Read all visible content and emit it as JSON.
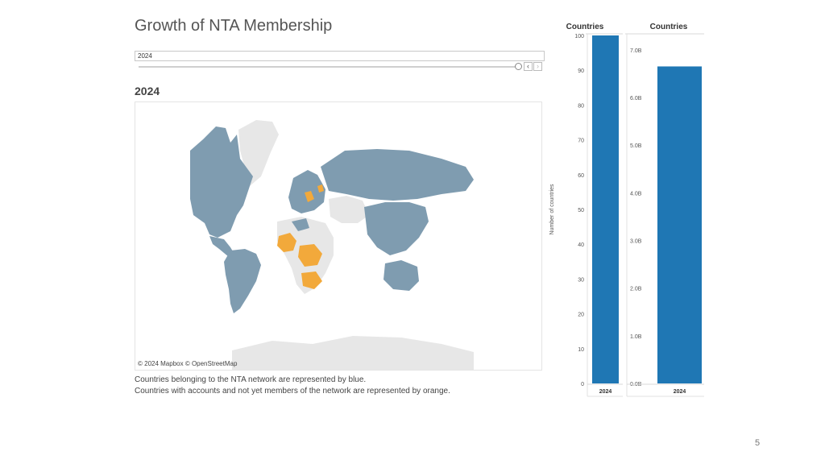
{
  "title": "Growth of NTA Membership",
  "filter": {
    "value": "2024"
  },
  "slider": {
    "prev_icon": "chevron-left-icon",
    "next_icon": "chevron-right-icon"
  },
  "map": {
    "heading": "2024",
    "attribution": "© 2024 Mapbox © OpenStreetMap",
    "colors": {
      "member": "#7f9cb0",
      "account": "#f2a93b",
      "land": "#e7e7e7",
      "ocean": "#ffffff"
    }
  },
  "notes": [
    "Countries belonging to the NTA network are represented by blue.",
    "Countries with accounts and not yet members of the network are represented by orange."
  ],
  "chart_data": [
    {
      "type": "bar",
      "title": "Countries",
      "categories": [
        "2024"
      ],
      "values": [
        100
      ],
      "ylabel": "Number of countries",
      "ylim": [
        0,
        100
      ],
      "yticks": [
        0,
        10,
        20,
        30,
        40,
        50,
        60,
        70,
        80,
        90,
        100
      ],
      "ytick_labels": [
        "0",
        "10",
        "20",
        "30",
        "40",
        "50",
        "60",
        "70",
        "80",
        "90",
        "100"
      ],
      "color": "#1f77b4"
    },
    {
      "type": "bar",
      "title": "Countries",
      "categories": [
        "2024"
      ],
      "values": [
        6.65
      ],
      "ylim": [
        0,
        7.3
      ],
      "yticks": [
        0,
        1,
        2,
        3,
        4,
        5,
        6,
        7
      ],
      "ytick_labels": [
        "0.0B",
        "1.0B",
        "2.0B",
        "3.0B",
        "4.0B",
        "5.0B",
        "6.0B",
        "7.0B"
      ],
      "color": "#1f77b4"
    }
  ],
  "page_number": "5"
}
